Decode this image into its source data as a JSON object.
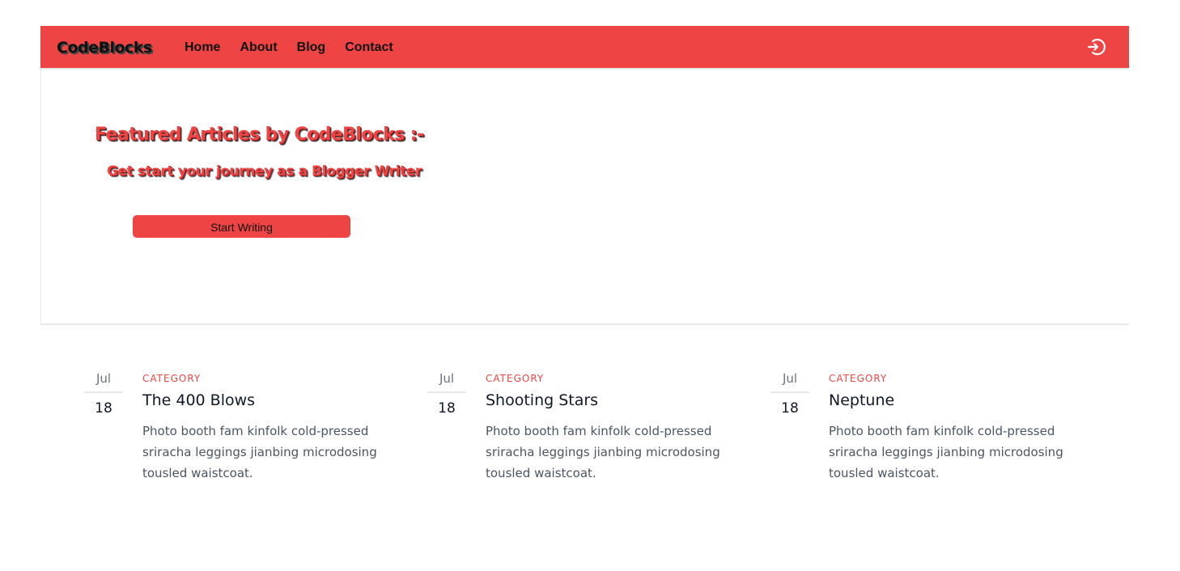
{
  "nav": {
    "brand": "CodeBlocks",
    "links": [
      "Home",
      "About",
      "Blog",
      "Contact"
    ],
    "login_icon": "login-arrow-circle-icon"
  },
  "hero": {
    "title": "Featured Articles by CodeBlocks :-",
    "subtitle": "Get start your journey as a Blogger Writer",
    "button": "Start Writing"
  },
  "posts": [
    {
      "month": "Jul",
      "day": "18",
      "category": "CATEGORY",
      "title": "The 400 Blows",
      "text": "Photo booth fam kinfolk cold-pressed sriracha leggings jianbing microdosing tousled waistcoat."
    },
    {
      "month": "Jul",
      "day": "18",
      "category": "CATEGORY",
      "title": "Shooting Stars",
      "text": "Photo booth fam kinfolk cold-pressed sriracha leggings jianbing microdosing tousled waistcoat."
    },
    {
      "month": "Jul",
      "day": "18",
      "category": "CATEGORY",
      "title": "Neptune",
      "text": "Photo booth fam kinfolk cold-pressed sriracha leggings jianbing microdosing tousled waistcoat."
    }
  ],
  "colors": {
    "accent": "#ef4444",
    "text_dark": "#111827",
    "text_muted": "#4b5563"
  }
}
